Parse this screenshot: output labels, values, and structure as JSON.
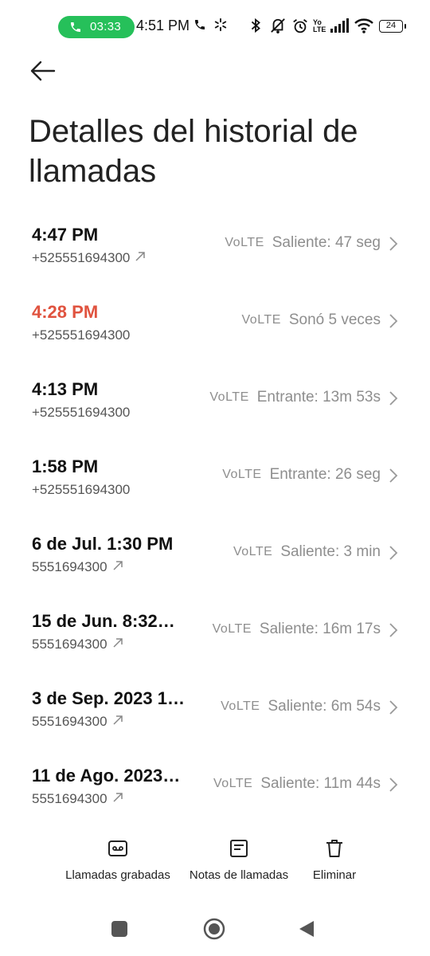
{
  "status_bar": {
    "call_timer": "03:33",
    "time": "4:51 PM",
    "battery": "24",
    "icons": [
      "phone-icon",
      "loading-icon",
      "bluetooth-icon",
      "vibrate-off-icon",
      "alarm-icon",
      "volte-icon",
      "signal-icon",
      "wifi-icon",
      "battery-icon"
    ]
  },
  "header": {
    "title": "Detalles del historial de llamadas"
  },
  "calls": [
    {
      "time": "4:47 PM",
      "number": "+525551694300",
      "outgoing": true,
      "tech": "VoLTE",
      "detail": "Saliente: 47 seg",
      "missed": false
    },
    {
      "time": "4:28 PM",
      "number": "+525551694300",
      "outgoing": false,
      "tech": "VoLTE",
      "detail": "Sonó 5 veces",
      "missed": true
    },
    {
      "time": "4:13 PM",
      "number": "+525551694300",
      "outgoing": false,
      "tech": "VoLTE",
      "detail": "Entrante: 13m 53s",
      "missed": false
    },
    {
      "time": "1:58 PM",
      "number": "+525551694300",
      "outgoing": false,
      "tech": "VoLTE",
      "detail": "Entrante: 26 seg",
      "missed": false
    },
    {
      "time": "6 de Jul. 1:30 PM",
      "number": "5551694300",
      "outgoing": true,
      "tech": "VoLTE",
      "detail": "Saliente: 3 min",
      "missed": false
    },
    {
      "time": "15 de Jun. 8:32…",
      "number": "5551694300",
      "outgoing": true,
      "tech": "VoLTE",
      "detail": "Saliente: 16m 17s",
      "missed": false
    },
    {
      "time": "3 de Sep. 2023 1…",
      "number": "5551694300",
      "outgoing": true,
      "tech": "VoLTE",
      "detail": "Saliente: 6m 54s",
      "missed": false
    },
    {
      "time": "11 de Ago. 2023…",
      "number": "5551694300",
      "outgoing": true,
      "tech": "VoLTE",
      "detail": "Saliente: 11m 44s",
      "missed": false
    }
  ],
  "actions": {
    "recorded": "Llamadas grabadas",
    "notes": "Notas de llamadas",
    "delete": "Eliminar"
  },
  "colors": {
    "accent_green": "#26c05a",
    "missed_red": "#e0533f",
    "secondary_text": "#8e8e8e"
  }
}
